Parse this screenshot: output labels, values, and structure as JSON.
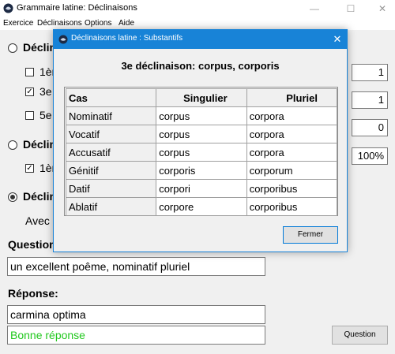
{
  "window": {
    "title": "Grammaire latine: Déclinaisons",
    "minimize": "—",
    "maximize": "☐",
    "close": "✕"
  },
  "menu": [
    "Exercice",
    "Déclinaisons",
    "Options",
    "Aide"
  ],
  "background": {
    "section1_label": "Déclin",
    "option1": "1èr",
    "option2": "3e",
    "option3": "5e",
    "section2_label": "Déclin",
    "option4": "1èr",
    "section3_label": "Déclin",
    "avec": "Avec l",
    "counters": [
      "1",
      "1",
      "0",
      "100%"
    ]
  },
  "question": {
    "label": "Question",
    "value": "un excellent poême, nominatif pluriel"
  },
  "reponse": {
    "label": "Réponse:",
    "value": "carmina optima",
    "feedback": "Bonne réponse"
  },
  "question_button": "Question",
  "dialog": {
    "title": "Déclinaisons latine : Substantifs",
    "close": "✕",
    "heading": "3e déclinaison: corpus, corporis",
    "columns": [
      "Cas",
      "Singulier",
      "Pluriel"
    ],
    "rows": [
      [
        "Nominatif",
        "corpus",
        "corpora"
      ],
      [
        "Vocatif",
        "corpus",
        "corpora"
      ],
      [
        "Accusatif",
        "corpus",
        "corpora"
      ],
      [
        "Génitif",
        "corporis",
        "corporum"
      ],
      [
        "Datif",
        "corpori",
        "corporibus"
      ],
      [
        "Ablatif",
        "corpore",
        "corporibus"
      ]
    ],
    "button": "Fermer"
  }
}
